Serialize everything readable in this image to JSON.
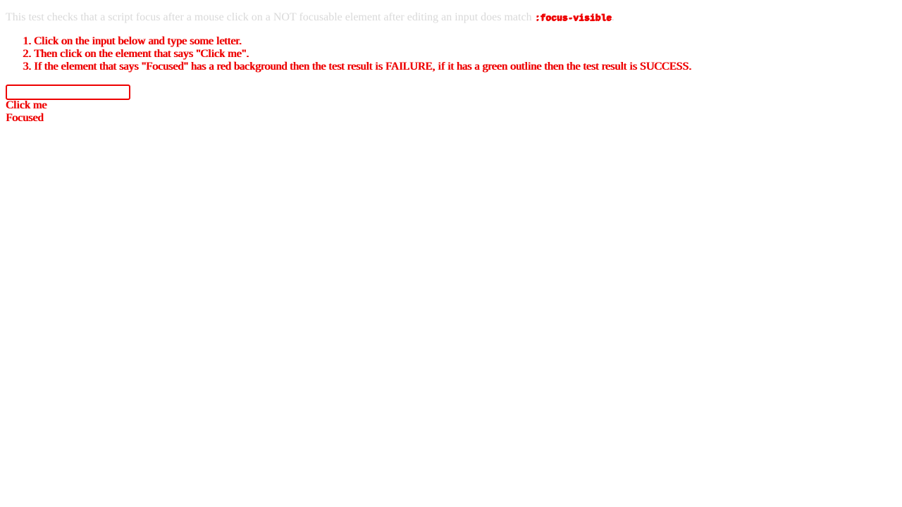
{
  "intro": {
    "text": "This test checks that a script focus after a mouse click on a NOT focusable element after editing an input does match ",
    "code": ":focus-visible",
    "trailing": "."
  },
  "steps": [
    {
      "num": "1.",
      "text": "Click on the input below and type some letter."
    },
    {
      "num": "2.",
      "text": "Then click on the element that says \"Click me\"."
    },
    {
      "num": "3.",
      "text": "If the element that says \"Focused\" has a red background then the test result is FAILURE, if it has a green outline then the test result is SUCCESS."
    }
  ],
  "input": {
    "value": ""
  },
  "click_target": {
    "label": "Click me"
  },
  "focused_target": {
    "label": "Focused"
  },
  "colors": {
    "accent": "#ee0000",
    "intro_text": "#d9d9d9"
  }
}
